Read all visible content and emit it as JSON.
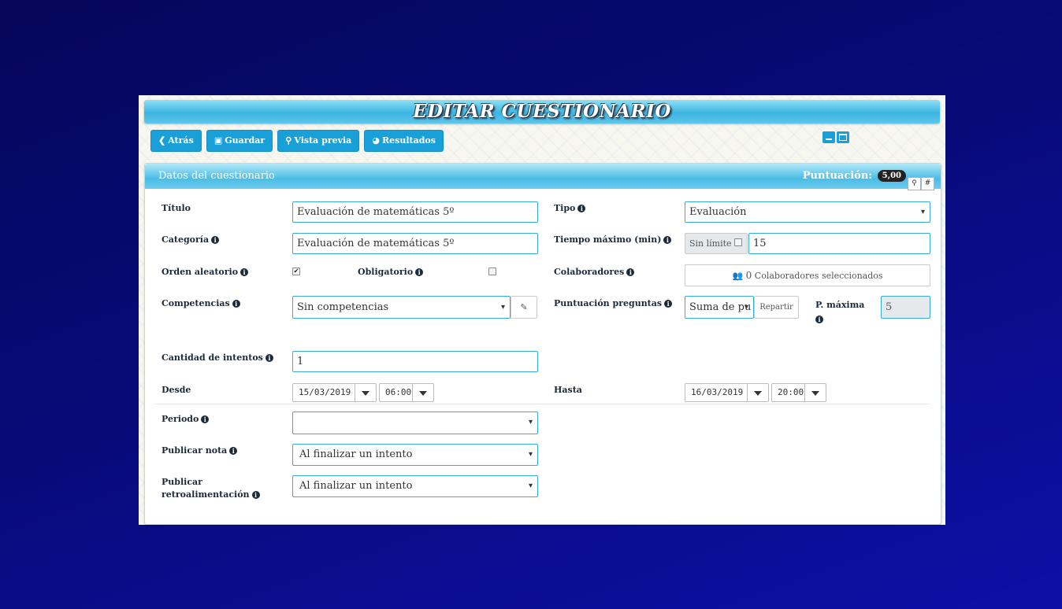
{
  "window": {
    "title": "EDITAR CUESTIONARIO"
  },
  "toolbar": {
    "back": "Atrás",
    "save": "Guardar",
    "preview": "Vista previa",
    "results": "Resultados"
  },
  "panel": {
    "title": "Datos del cuestionario",
    "score_label": "Puntuación:",
    "score_value": "5,00",
    "search_btn": "🔍",
    "hash_btn": "#"
  },
  "form": {
    "titulo_label": "Título",
    "titulo_value": "Evaluación de matemáticas 5º",
    "categoria_label": "Categoría",
    "categoria_value": "Evaluación de matemáticas 5º",
    "orden_label": "Orden aleatorio",
    "orden_checked": true,
    "obligatorio_label": "Obligatorio",
    "obligatorio_checked": false,
    "competencias_label": "Competencias",
    "competencias_value": "Sin competencias",
    "tipo_label": "Tipo",
    "tipo_value": "Evaluación",
    "tiempo_label": "Tiempo máximo (min)",
    "sin_limite": "Sin límite",
    "tiempo_value": "15",
    "colaboradores_label": "Colaboradores",
    "colaboradores_count": "0",
    "colaboradores_text": "Colaboradores seleccionados",
    "puntuacion_label": "Puntuación preguntas",
    "puntuacion_value": "Suma de pu",
    "repartir": "Repartir",
    "pmax_label_1": "P. máxima",
    "pmax_value": "5",
    "intentos_label": "Cantidad de intentos",
    "intentos_value": "1",
    "desde_label": "Desde",
    "desde_date": "15/03/2019",
    "desde_time": "06:00",
    "hasta_label": "Hasta",
    "hasta_date": "16/03/2019",
    "hasta_time": "20:00",
    "periodo_label": "Periodo",
    "periodo_value": "",
    "publicar_nota_label": "Publicar nota",
    "publicar_nota_value": "Al finalizar un intento",
    "publicar_retro_label_1": "Publicar",
    "publicar_retro_label_2": "retroalimentación",
    "publicar_retro_value": "Al finalizar un intento"
  },
  "colors": {
    "accent": "#1aa0d8",
    "header": "#49bde6",
    "background": "#080a78"
  }
}
